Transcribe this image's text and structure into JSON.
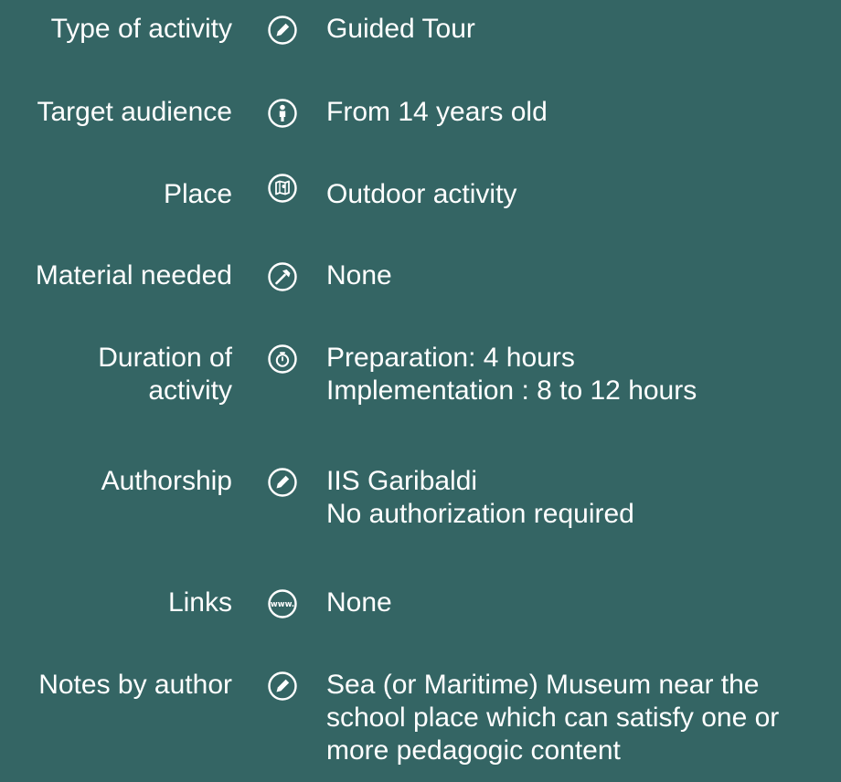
{
  "rows": [
    {
      "label": "Type of activity",
      "icon": "pencil-icon",
      "lines": [
        "Guided Tour"
      ]
    },
    {
      "label": "Target audience",
      "icon": "person-icon",
      "lines": [
        "From 14 years old"
      ]
    },
    {
      "label": "Place",
      "icon": "map-pin-icon",
      "lines": [
        "Outdoor activity"
      ]
    },
    {
      "label": "Material needed",
      "icon": "hammer-icon",
      "lines": [
        "None"
      ]
    },
    {
      "label": "Duration of\nactivity",
      "icon": "stopwatch-icon",
      "lines": [
        "Preparation: 4 hours",
        "Implementation : 8 to 12 hours"
      ]
    },
    {
      "label": "Authorship",
      "icon": "pencil-icon",
      "lines": [
        "IIS Garibaldi",
        "No authorization required"
      ]
    },
    {
      "label": "Links",
      "icon": "www-icon",
      "lines": [
        "None"
      ]
    },
    {
      "label": "Notes by author",
      "icon": "pencil-icon",
      "lines": [
        "Sea (or Maritime) Museum near the",
        "school place which can satisfy one or",
        "more pedagogic content"
      ]
    }
  ]
}
